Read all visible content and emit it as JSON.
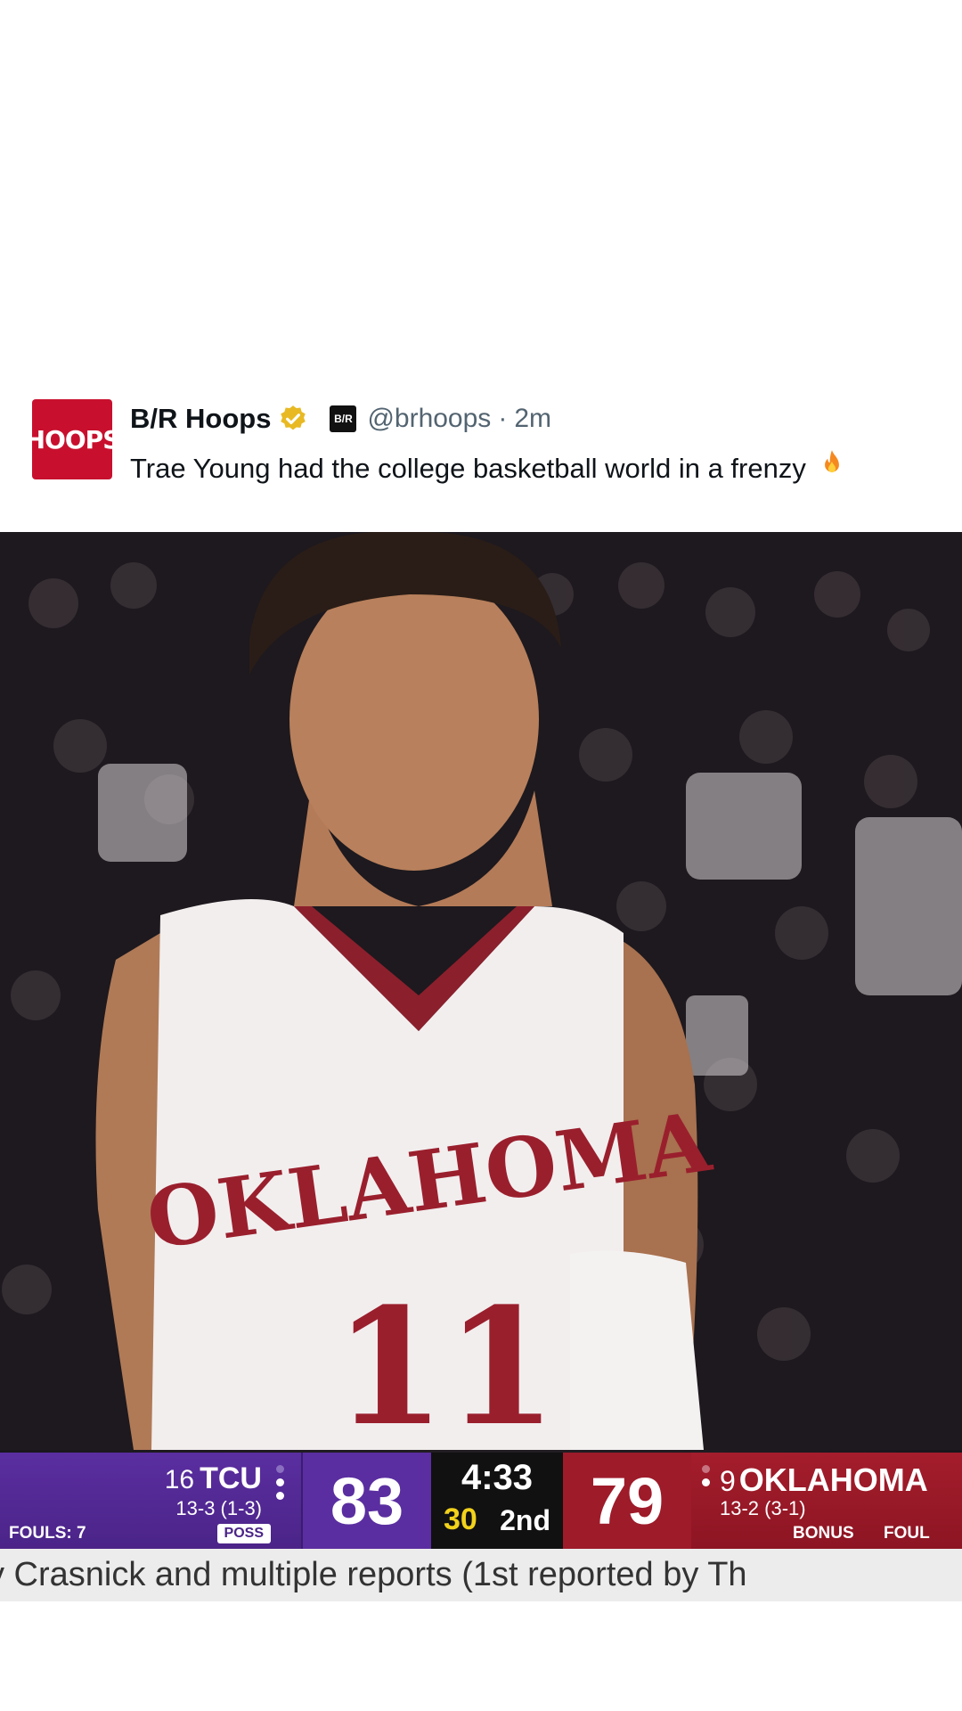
{
  "post": {
    "avatar_text": "HOOPS",
    "account_name": "B/R Hoops",
    "br_badge": "B/R",
    "handle": "@brhoops",
    "separator": "·",
    "timestamp": "2m",
    "text": "Trae Young had the college basketball world in a frenzy"
  },
  "video": {
    "jersey_team": "OKLAHOMA",
    "jersey_number": "11",
    "scoreboard": {
      "away": {
        "rank": "16",
        "team": "TCU",
        "record": "13-3 (1-3)",
        "score": "83",
        "fouls": "FOULS: 7",
        "possession": "POSS",
        "timeouts_remaining": 2,
        "timeouts_used": 1
      },
      "clock": {
        "time": "4:33",
        "shot_clock": "30",
        "period": "2nd"
      },
      "home": {
        "rank": "9",
        "team": "OKLAHOMA",
        "record": "13-2 (3-1)",
        "score": "79",
        "bonus": "BONUS",
        "fouls": "FOUL",
        "timeouts_remaining": 1,
        "timeouts_used": 1
      }
    },
    "ticker_text": "y Crasnick and multiple reports (1st reported by Th"
  },
  "colors": {
    "brand_red": "#c8102e",
    "tcu_purple": "#4b2488",
    "oklahoma_crimson": "#9e1b2a",
    "shot_clock_yellow": "#f2d21b",
    "verified_gold": "#e8b923"
  },
  "icons": {
    "verified": "verified-badge-icon",
    "fire": "fire-emoji-icon",
    "br": "br-logo-icon"
  }
}
